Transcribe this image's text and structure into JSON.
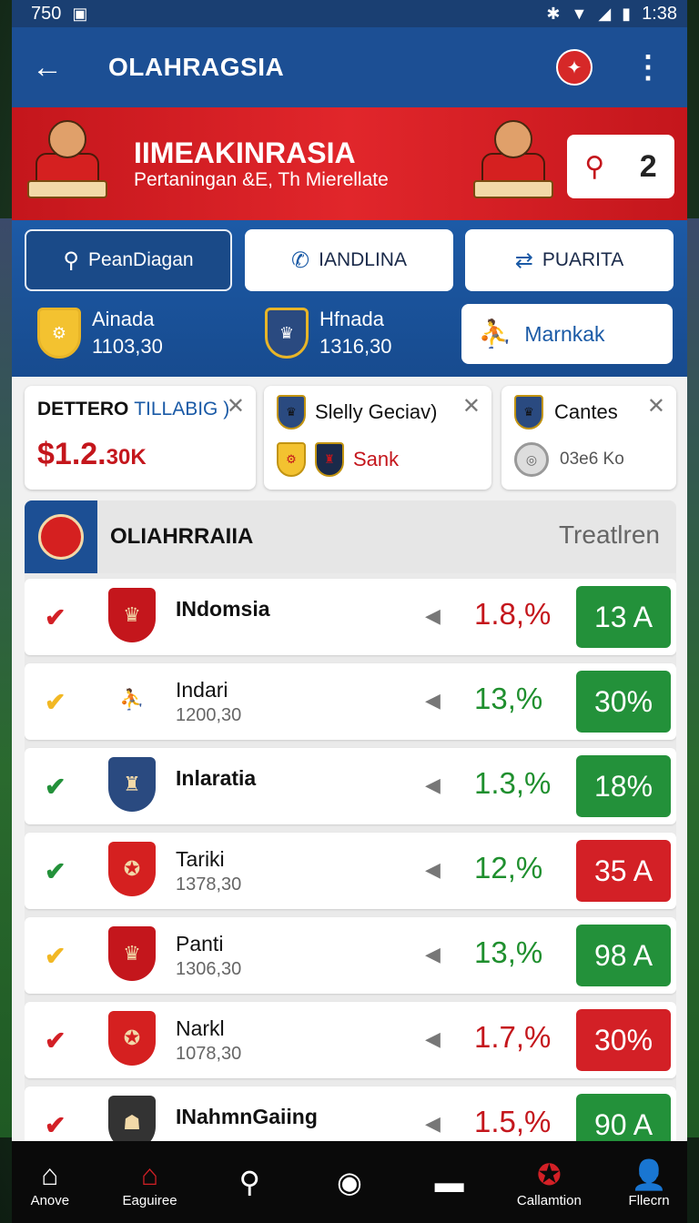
{
  "status_bar": {
    "left_text": "750",
    "time": "1:38"
  },
  "app_bar": {
    "title": "OLAHRAGSIA"
  },
  "banner": {
    "title": "IIMEAKINRASIA",
    "subtitle": "Pertaningan &E, Th Mierellate",
    "search_count": "2"
  },
  "controls": {
    "buttons": [
      "PeanDiagan",
      "IANDLINA",
      "PUARITA"
    ],
    "teams": [
      {
        "name": "Ainada",
        "value": "1103,30"
      },
      {
        "name": "Hfnada",
        "value": "1316,30"
      }
    ],
    "link_label": "Marnkak"
  },
  "cards": [
    {
      "title_main": "DETTERO",
      "title_highlight": "TILLABIG )",
      "amount_big": "$1.2.",
      "amount_small": "30K"
    },
    {
      "title": "Slelly Geciav)",
      "subtitle": "Sank"
    },
    {
      "title": "Cantes",
      "subtitle": "03e6 Ko"
    }
  ],
  "table": {
    "title": "OLIAHRRAIIA",
    "right_label": "Treatlren",
    "rows": [
      {
        "name": "INdomsia",
        "sub": "",
        "pct": "1.8,%",
        "badge": "13 A",
        "pct_color": "#c4161c",
        "badge_color": "#23913a",
        "check": "red"
      },
      {
        "name": "Indari",
        "sub": "1200,30",
        "pct": "13,%",
        "badge": "30%",
        "pct_color": "#1f8f2e",
        "badge_color": "#23913a",
        "check": "yellow"
      },
      {
        "name": "Inlaratia",
        "sub": "",
        "pct": "1.3,%",
        "badge": "18%",
        "pct_color": "#1f8f2e",
        "badge_color": "#23913a",
        "check": "green"
      },
      {
        "name": "Tariki",
        "sub": "1378,30",
        "pct": "12,%",
        "badge": "35 A",
        "pct_color": "#1f8f2e",
        "badge_color": "#d32026",
        "check": "green"
      },
      {
        "name": "Panti",
        "sub": "1306,30",
        "pct": "13,%",
        "badge": "98 A",
        "pct_color": "#1f8f2e",
        "badge_color": "#23913a",
        "check": "yellow"
      },
      {
        "name": "Narkl",
        "sub": "1078,30",
        "pct": "1.7,%",
        "badge": "30%",
        "pct_color": "#c4161c",
        "badge_color": "#d32026",
        "check": "red"
      },
      {
        "name": "INahmnGaiing",
        "sub": "",
        "pct": "1.5,%",
        "badge": "90 A",
        "pct_color": "#c4161c",
        "badge_color": "#23913a",
        "check": "red"
      }
    ]
  },
  "bottom_nav": [
    "Anove",
    "Eaguiree",
    "",
    "",
    "",
    "Callamtion",
    "Fllecrn"
  ],
  "colors": {
    "primary_blue": "#1c4f94",
    "accent_red": "#c4161c",
    "green": "#23913a"
  }
}
